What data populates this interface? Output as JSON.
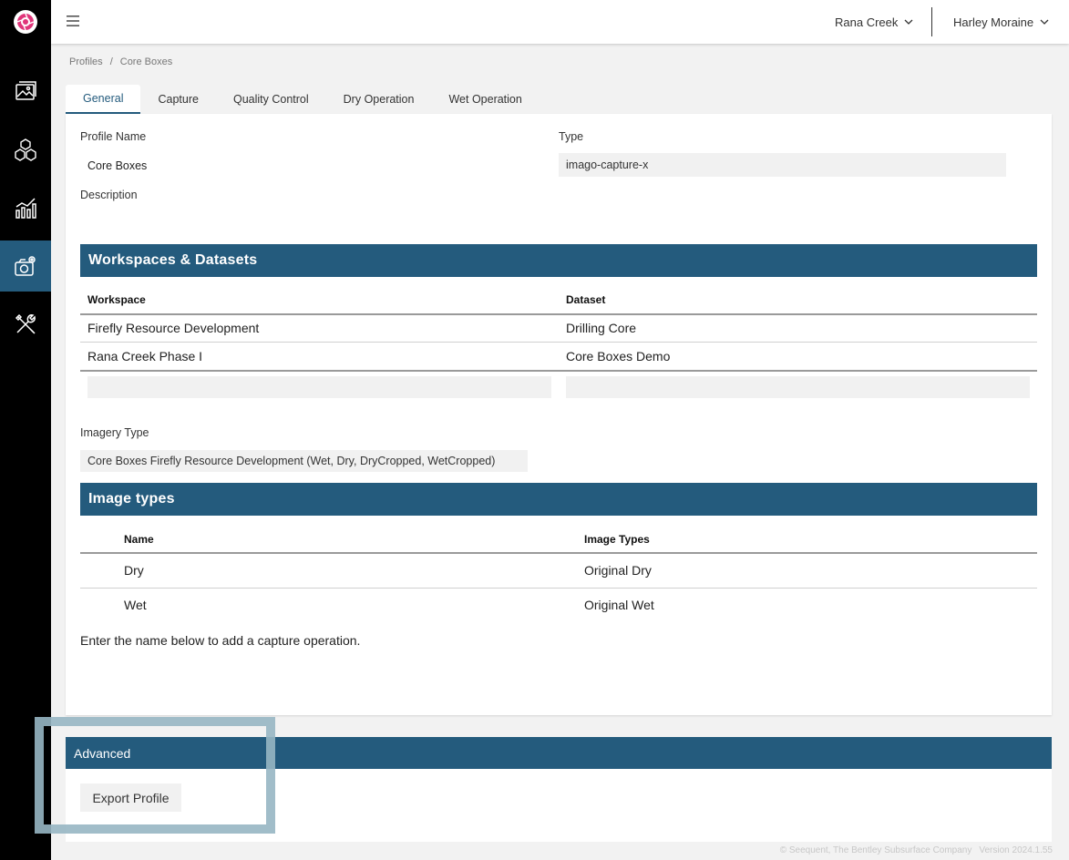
{
  "header": {
    "workspace_selector": "Rana Creek",
    "user_menu": "Harley Moraine"
  },
  "breadcrumb": {
    "root": "Profiles",
    "separator": "/",
    "current": "Core Boxes"
  },
  "tabs": [
    {
      "label": "General",
      "active": true
    },
    {
      "label": "Capture",
      "active": false
    },
    {
      "label": "Quality Control",
      "active": false
    },
    {
      "label": "Dry Operation",
      "active": false
    },
    {
      "label": "Wet Operation",
      "active": false
    }
  ],
  "general": {
    "profile_name_label": "Profile Name",
    "profile_name_value": "Core Boxes",
    "type_label": "Type",
    "type_value": "imago-capture-x",
    "description_label": "Description"
  },
  "workspaces": {
    "title": "Workspaces & Datasets",
    "columns": [
      "Workspace",
      "Dataset"
    ],
    "rows": [
      [
        "Firefly Resource Development",
        "Drilling Core"
      ],
      [
        "Rana Creek Phase I",
        "Core Boxes Demo"
      ]
    ]
  },
  "imagery": {
    "label": "Imagery Type",
    "value": "Core Boxes Firefly Resource Development (Wet, Dry, DryCropped, WetCropped)"
  },
  "image_types": {
    "title": "Image types",
    "columns": [
      "Name",
      "Image Types"
    ],
    "rows": [
      [
        "Dry",
        "Original Dry"
      ],
      [
        "Wet",
        "Original Wet"
      ]
    ],
    "hint": "Enter the name below to add a capture operation."
  },
  "advanced": {
    "title": "Advanced",
    "export_label": "Export Profile"
  },
  "footer": {
    "copyright": "© Seequent, The Bentley Subsurface Company",
    "version": "Version 2024.1.55"
  },
  "colors": {
    "accent": "#245b7d",
    "sidebar": "#000000",
    "logo": "#e0357a",
    "highlight": "#97b6c3"
  }
}
